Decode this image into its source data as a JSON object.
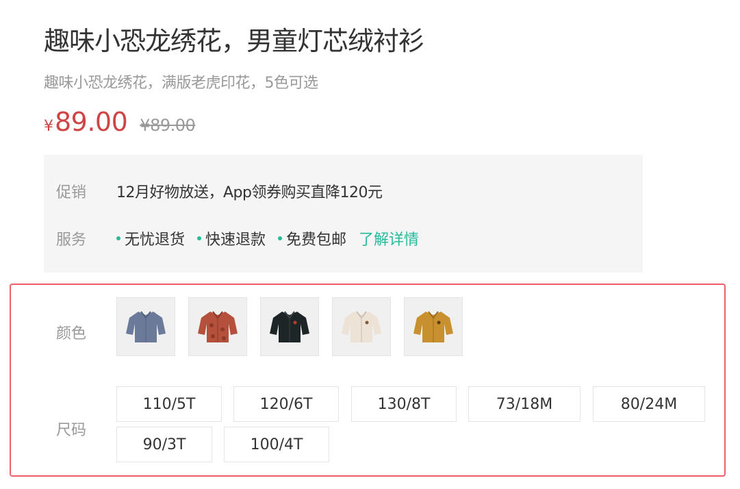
{
  "product": {
    "title": "趣味小恐龙绣花，男童灯芯绒衬衫",
    "subtitle": "趣味小恐龙绣花，满版老虎印花，5色可选",
    "price_symbol": "¥",
    "price_now": "89.00",
    "price_old": "¥89.00"
  },
  "info": {
    "promo_label": "促销",
    "promo_text": "12月好物放送，App领券购买直降120元",
    "service_label": "服务",
    "services": [
      "无忧退货",
      "快速退款",
      "免费包邮"
    ],
    "service_link": "了解详情"
  },
  "sku": {
    "color_label": "颜色",
    "colors": [
      {
        "name": "denim-blue-shirt",
        "hex": "#6a7a98"
      },
      {
        "name": "rust-red-print-shirt",
        "hex": "#b5503c"
      },
      {
        "name": "black-shirt",
        "hex": "#1e2527"
      },
      {
        "name": "cream-shirt",
        "hex": "#ece2d6"
      },
      {
        "name": "mustard-yellow-shirt",
        "hex": "#c9902e"
      }
    ],
    "size_label": "尺码",
    "sizes": [
      "110/5T",
      "120/6T",
      "130/8T",
      "73/18M",
      "80/24M",
      "90/3T",
      "100/4T"
    ]
  },
  "colors": {
    "price_red": "#cf4444",
    "accent_green": "#27ba9b",
    "highlight_border": "#ec5f6a",
    "info_bg": "#f5f5f5"
  }
}
